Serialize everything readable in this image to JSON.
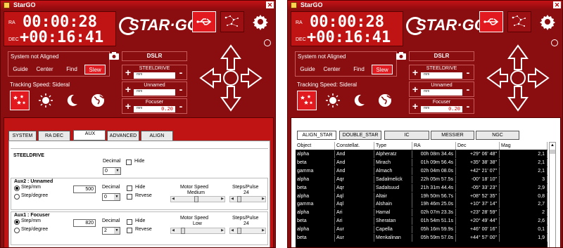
{
  "window_title": "StarGO",
  "clock": {
    "ra_label": "RA",
    "ra_value": "00:00:28",
    "dec_label": "DEC",
    "dec_value": "+00:16:41"
  },
  "logo_text": "STAR·GO",
  "mount": {
    "status": "System not Aligned",
    "buttons": [
      "Guide",
      "Center",
      "Find",
      "Slew"
    ],
    "active_button": "Slew"
  },
  "tracking": {
    "label": "Tracking Speed: Sideral",
    "icons": [
      "stars-icon",
      "sun-icon",
      "moon-icon",
      "globe-icon"
    ],
    "active_icon": "stars-icon"
  },
  "dslr_label": "DSLR",
  "focusers": [
    {
      "name": "STEELDRIVE",
      "unit": "mm",
      "value": ""
    },
    {
      "name": "Unnamed",
      "unit": "mm",
      "value": ""
    },
    {
      "name": "Focuser",
      "unit": "mm",
      "value": "0.20"
    }
  ],
  "left_tabs": [
    "SYSTEM",
    "RA DEC",
    "AUX",
    "ADVANCED",
    "ALIGN"
  ],
  "left_active_tab": "AUX",
  "aux": {
    "steeldrive": {
      "title": "STEELDRIVE",
      "decimal_label": "Decimal",
      "decimal_value": "0",
      "hide_label": "Hide"
    },
    "aux2": {
      "title": "Aux2 : Unnamed",
      "step_mm": "Step/mm",
      "step_degree": "Step/degree",
      "step_value": "500",
      "decimal_label": "Decimal",
      "decimal_value": "0",
      "hide_label": "Hide",
      "reverse_label": "Revese",
      "motor_speed_label": "Motor Speed",
      "motor_speed_value": "Medium",
      "steps_pulse_label": "Steps/Pulse",
      "steps_pulse_value": "24"
    },
    "aux1": {
      "title": "Aux1 : Focuser",
      "step_mm": "Step/mm",
      "step_degree": "Step/degree",
      "step_value": "820",
      "decimal_label": "Decimal",
      "decimal_value": "2",
      "hide_label": "Hide",
      "reverse_label": "Revese",
      "motor_speed_label": "Motor Speed",
      "motor_speed_value": "Low",
      "steps_pulse_label": "Steps/Pulse",
      "steps_pulse_value": "24"
    }
  },
  "right_tabs": [
    "ALIGN_STAR",
    "DOUBLE_STAR",
    "IC",
    "MESSIER",
    "NGC"
  ],
  "right_active_tab": "ALIGN_STAR",
  "table": {
    "columns": [
      "Object",
      "Constellat.",
      "Type",
      "RA",
      "Dec",
      "Mag"
    ],
    "rows": [
      [
        "alpha",
        "And",
        "Alpheratz",
        "00h 08m 34.4s",
        "+29° 06' 48\"",
        "2,1"
      ],
      [
        "beta",
        "And",
        "Mirach",
        "01h 09m 56.4s",
        "+35° 38' 38\"",
        "2,1"
      ],
      [
        "gamma",
        "And",
        "Almach",
        "02h 04m 08.0s",
        "+42° 21' 07\"",
        "2,1"
      ],
      [
        "alpha",
        "Aqr",
        "Sadalmelick",
        "22h 05m 57.5s",
        "-00° 18' 10\"",
        "3"
      ],
      [
        "beta",
        "Aqr",
        "Sadalsuud",
        "21h 31m 44.4s",
        "-05° 33' 23\"",
        "2,9"
      ],
      [
        "alpha",
        "Aql",
        "Altair",
        "19h 50m 56.7s",
        "+08° 52' 35\"",
        "0,8"
      ],
      [
        "gamma",
        "Aql",
        "Alshain",
        "19h 46m 25.0s",
        "+10° 37' 14\"",
        "2,7"
      ],
      [
        "alpha",
        "Ari",
        "Hamal",
        "02h 07m 23.3s",
        "+23° 28' 59\"",
        "2"
      ],
      [
        "beta",
        "Ari",
        "Sheratan",
        "01h 54m 51.1s",
        "+20° 49' 44\"",
        "2,6"
      ],
      [
        "alpha",
        "Aur",
        "Capella",
        "05h 16m 59.9s",
        "+46° 00' 16\"",
        "0,1"
      ],
      [
        "beta",
        "Aur",
        "Menkalinan",
        "05h 59m 57.0s",
        "+44° 57' 00\"",
        "1,9"
      ]
    ]
  }
}
